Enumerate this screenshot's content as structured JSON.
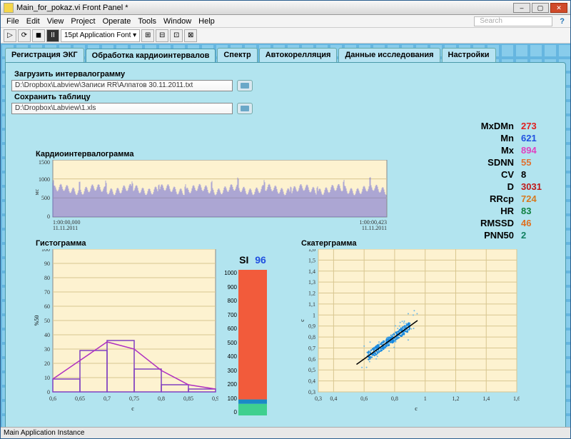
{
  "window": {
    "title": "Main_for_pokaz.vi Front Panel *"
  },
  "menu": {
    "file": "File",
    "edit": "Edit",
    "view": "View",
    "project": "Project",
    "operate": "Operate",
    "tools": "Tools",
    "window": "Window",
    "help": "Help",
    "search_placeholder": "Search"
  },
  "toolbar": {
    "font": "15pt Application Font"
  },
  "tabs": {
    "t1": "Регистрация ЭКГ",
    "t2": "Обработка кардиоинтервалов",
    "t3": "Спектр",
    "t4": "Автокорелляция",
    "t5": "Данные исследования",
    "t6": "Настройки"
  },
  "fields": {
    "load_label": "Загрузить интервалограмму",
    "load_path": "D:\\Dropbox\\Labview\\Записи RR\\Алпатов 30.11.2011.txt",
    "save_label": "Сохранить таблицу",
    "save_path": "D:\\Dropbox\\Labview\\1.xls"
  },
  "stats": {
    "MxDMn": {
      "v": "273",
      "c": "#e02020"
    },
    "Mn": {
      "v": "621",
      "c": "#2050e0"
    },
    "Mx": {
      "v": "894",
      "c": "#e040c0"
    },
    "SDNN": {
      "v": "55",
      "c": "#e07030"
    },
    "CV": {
      "v": "8",
      "c": "#000"
    },
    "D": {
      "v": "3031",
      "c": "#c01818"
    },
    "RRcp": {
      "v": "724",
      "c": "#d67a20"
    },
    "HR": {
      "v": "83",
      "c": "#108040"
    },
    "RMSSD": {
      "v": "46",
      "c": "#e07020"
    },
    "PNN50": {
      "v": "2",
      "c": "#108060"
    }
  },
  "si": {
    "label": "SI",
    "value": "96"
  },
  "plots": {
    "interval_title": "Кардиоинтервалограмма",
    "hist_title": "Гистограмма",
    "scatter_title": "Скатерграмма",
    "interval_y_unit": "мс",
    "interval_x_start": "1:00:00,000\n11.11.2011",
    "interval_x_end": "1:00:00,423\n11.11.2011",
    "hist_y_unit": "%50",
    "hist_x_unit": "с",
    "scatter_axis_unit": "с"
  },
  "status": {
    "instance": "Main Application Instance"
  },
  "chart_data": [
    {
      "type": "line",
      "name": "intervalogram",
      "title": "Кардиоинтервалограмма",
      "ylabel": "мс",
      "ylim": [
        0,
        1500
      ],
      "yticks": [
        0,
        500,
        1000,
        1500
      ],
      "xlim": [
        "1:00:00,000",
        "1:00:00,423"
      ],
      "note": "dense RR-interval time series oscillating roughly 600–900 ms"
    },
    {
      "type": "bar",
      "name": "histogram",
      "title": "Гистограмма",
      "xlabel": "с",
      "ylabel": "%50",
      "xlim": [
        0.6,
        0.9
      ],
      "ylim": [
        0,
        100
      ],
      "xticks": [
        0.6,
        0.65,
        0.7,
        0.75,
        0.8,
        0.85,
        0.9
      ],
      "yticks": [
        0,
        10,
        20,
        30,
        40,
        50,
        60,
        70,
        80,
        90,
        100
      ],
      "categories": [
        0.625,
        0.675,
        0.725,
        0.775,
        0.825,
        0.875
      ],
      "values": [
        9,
        29,
        36,
        16,
        5,
        2
      ],
      "overlay_curve": {
        "x": [
          0.6,
          0.65,
          0.7,
          0.75,
          0.8,
          0.85,
          0.9
        ],
        "y": [
          9,
          22,
          35,
          30,
          15,
          5,
          2
        ]
      }
    },
    {
      "type": "bar",
      "name": "si_gauge",
      "title": "SI",
      "ylim": [
        0,
        1000
      ],
      "yticks": [
        0,
        100,
        200,
        300,
        400,
        500,
        600,
        700,
        800,
        900,
        1000
      ],
      "segments": [
        {
          "from": 0,
          "to": 80,
          "color": "#3fd08f"
        },
        {
          "from": 80,
          "to": 110,
          "color": "#1a8ac6"
        },
        {
          "from": 110,
          "to": 1000,
          "color": "#f25b3b"
        }
      ],
      "pointer": 96
    },
    {
      "type": "scatter",
      "name": "scattergram",
      "title": "Скатерграмма",
      "xlabel": "с",
      "ylabel": "с",
      "xlim": [
        0.3,
        1.6
      ],
      "ylim": [
        0.3,
        1.6
      ],
      "xticks": [
        0.3,
        0.4,
        0.6,
        0.8,
        1.0,
        1.2,
        1.4,
        1.6
      ],
      "yticks": [
        0.3,
        0.4,
        0.5,
        0.6,
        0.7,
        0.8,
        0.9,
        1.0,
        1.1,
        1.2,
        1.3,
        1.4,
        1.5,
        1.6
      ],
      "note": "Poincaré plot, dense cluster along diagonal ~0.6–0.9",
      "fit_line": {
        "x": [
          0.55,
          0.95
        ],
        "y": [
          0.55,
          0.95
        ]
      }
    }
  ]
}
